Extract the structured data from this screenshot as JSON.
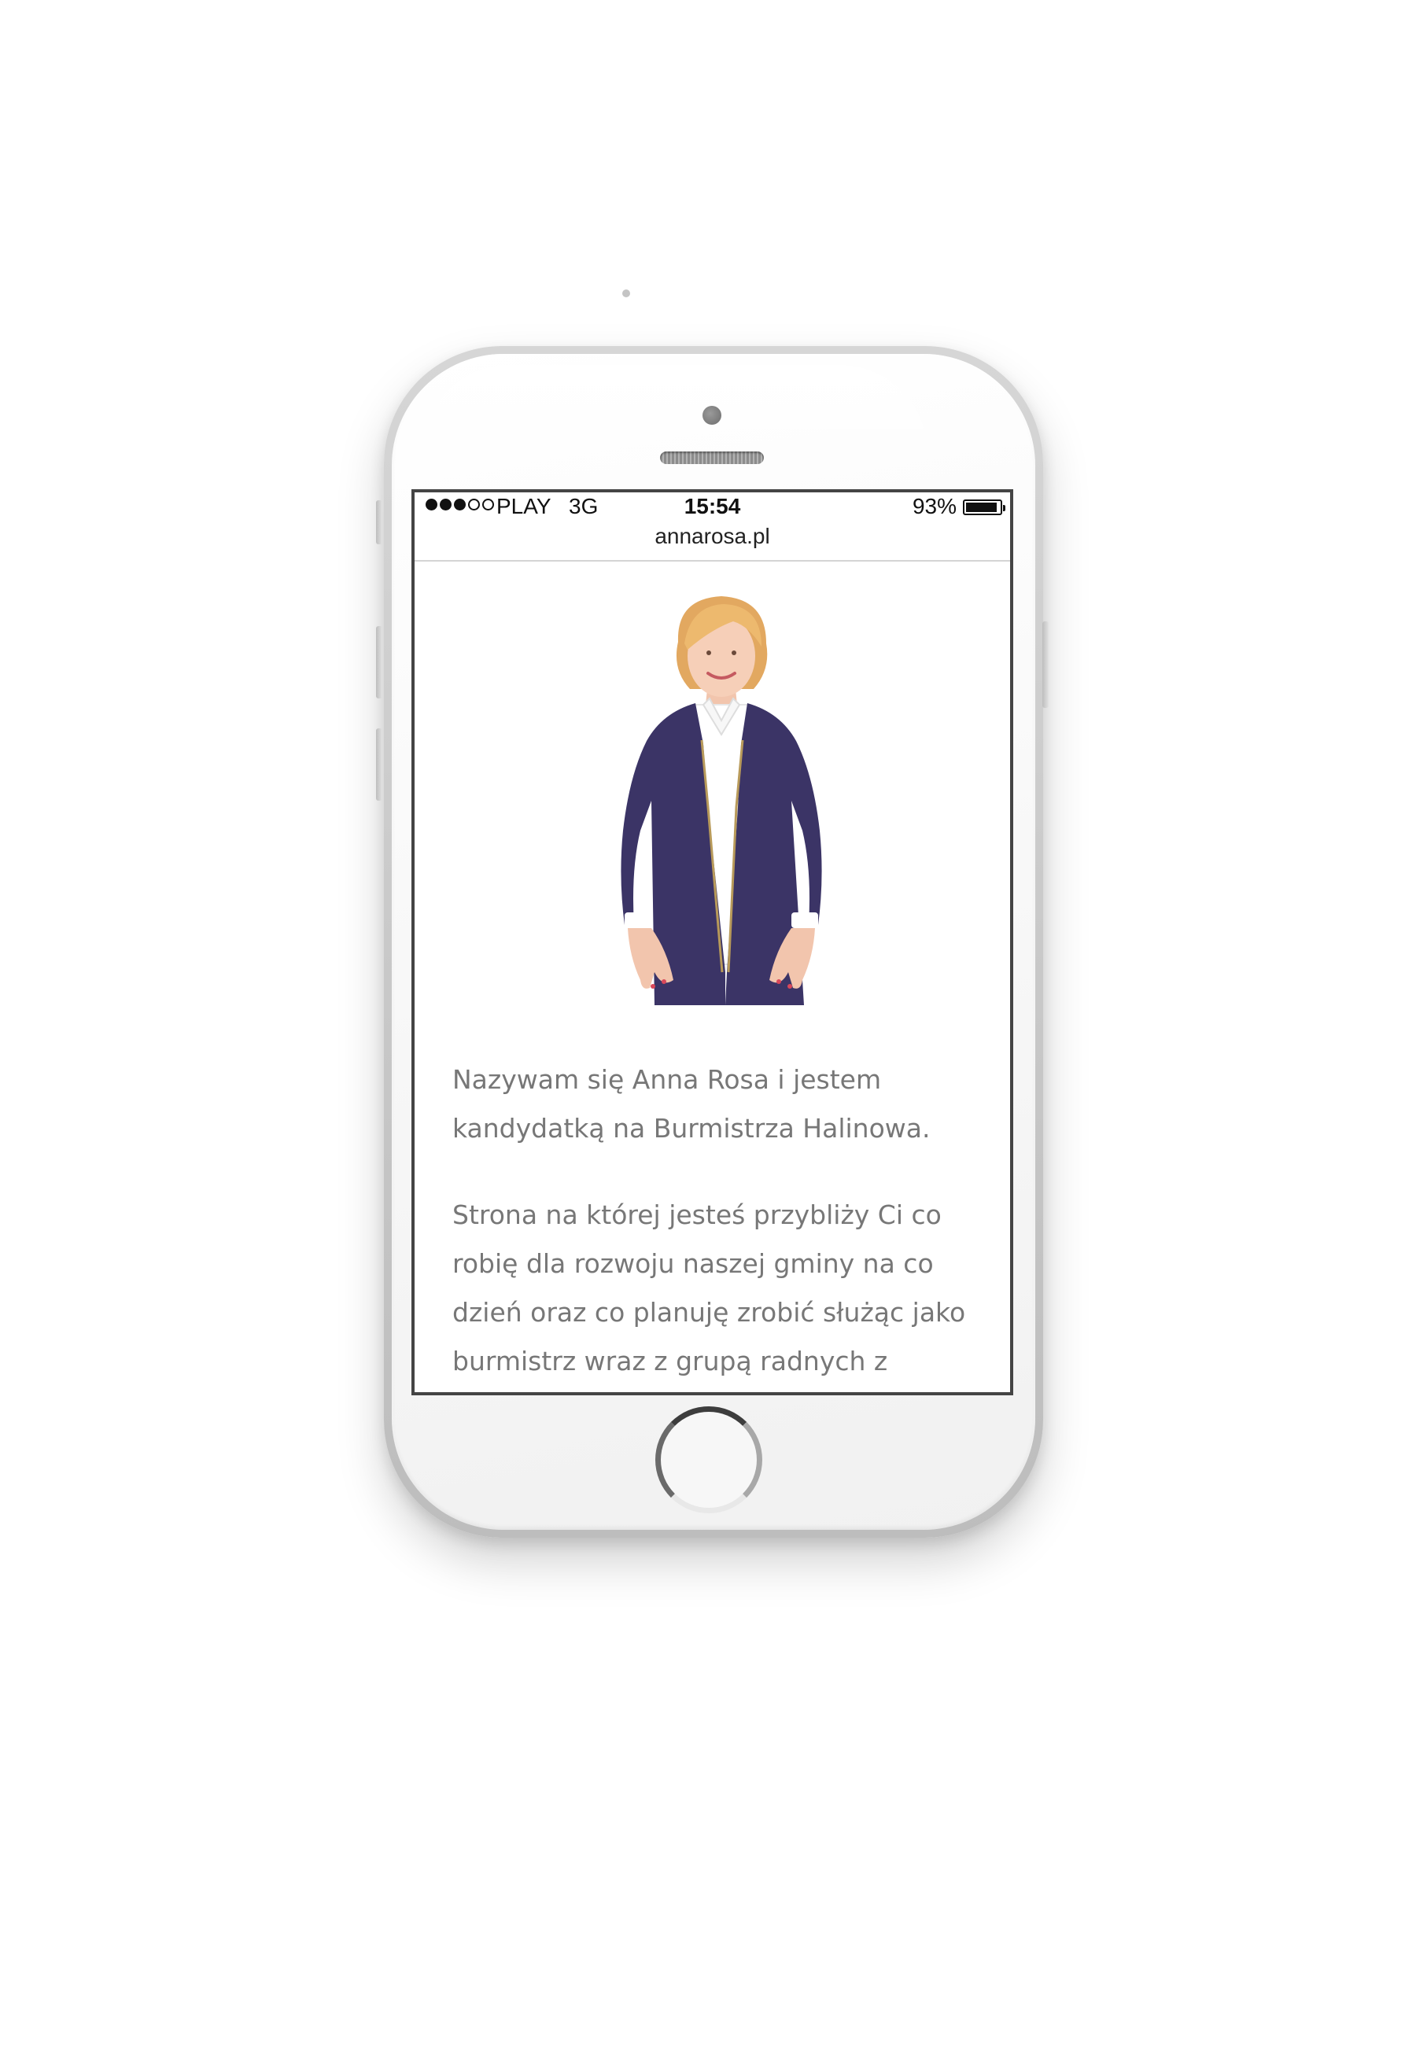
{
  "status_bar": {
    "signal_dots_filled": 3,
    "signal_dots_total": 5,
    "carrier": "PLAY",
    "network": "3G",
    "time": "15:54",
    "battery_percent": "93%",
    "battery_level": 0.93
  },
  "browser": {
    "url": "annarosa.pl"
  },
  "page": {
    "portrait_alt": "Anna Rosa",
    "paragraph_1": "Nazywam się Anna Rosa i jestem kandydatką na Burmistrza Halinowa.",
    "paragraph_2": "Strona na której jesteś przybliży Ci co robię dla rozwoju naszej gminy na co dzień oraz co planuję zrobić służąc jako burmistrz wraz z grupą radnych z"
  },
  "colors": {
    "jacket": "#3b3466",
    "hair": "#e8b46c",
    "shirt": "#ffffff",
    "body_text": "#777777",
    "screen_border": "#444444"
  }
}
